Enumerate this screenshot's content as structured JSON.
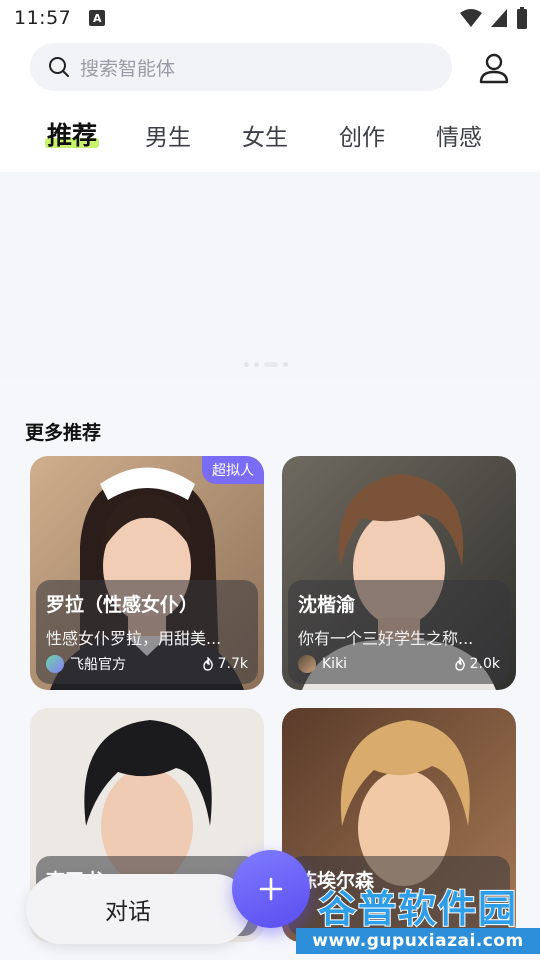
{
  "status_bar": {
    "time": "11:57",
    "notification_icon": "A"
  },
  "search": {
    "placeholder": "搜索智能体"
  },
  "tabs": [
    {
      "label": "推荐",
      "active": true
    },
    {
      "label": "男生",
      "active": false
    },
    {
      "label": "女生",
      "active": false
    },
    {
      "label": "创作",
      "active": false
    },
    {
      "label": "情感",
      "active": false
    }
  ],
  "section": {
    "title": "更多推荐"
  },
  "cards": [
    {
      "name": "罗拉（性感女仆）",
      "description": "性感女仆罗拉，用甜美...",
      "author": "飞船官方",
      "heat": "7.7k",
      "badge": "超拟人"
    },
    {
      "name": "沈楷渝",
      "description": "你有一个三好学生之称...",
      "author": "Kiki",
      "heat": "2.0k"
    },
    {
      "name": "李玉书"
    },
    {
      "name": "陈埃尔森"
    }
  ],
  "bottom": {
    "chat_label": "对话"
  },
  "watermark": {
    "title": "谷普软件园",
    "url": "www.gupuxiazai.com"
  },
  "colors": {
    "accent": "#6e5ff5",
    "tab_highlight": "#c8f26b",
    "badge": "#7b6cf6"
  }
}
